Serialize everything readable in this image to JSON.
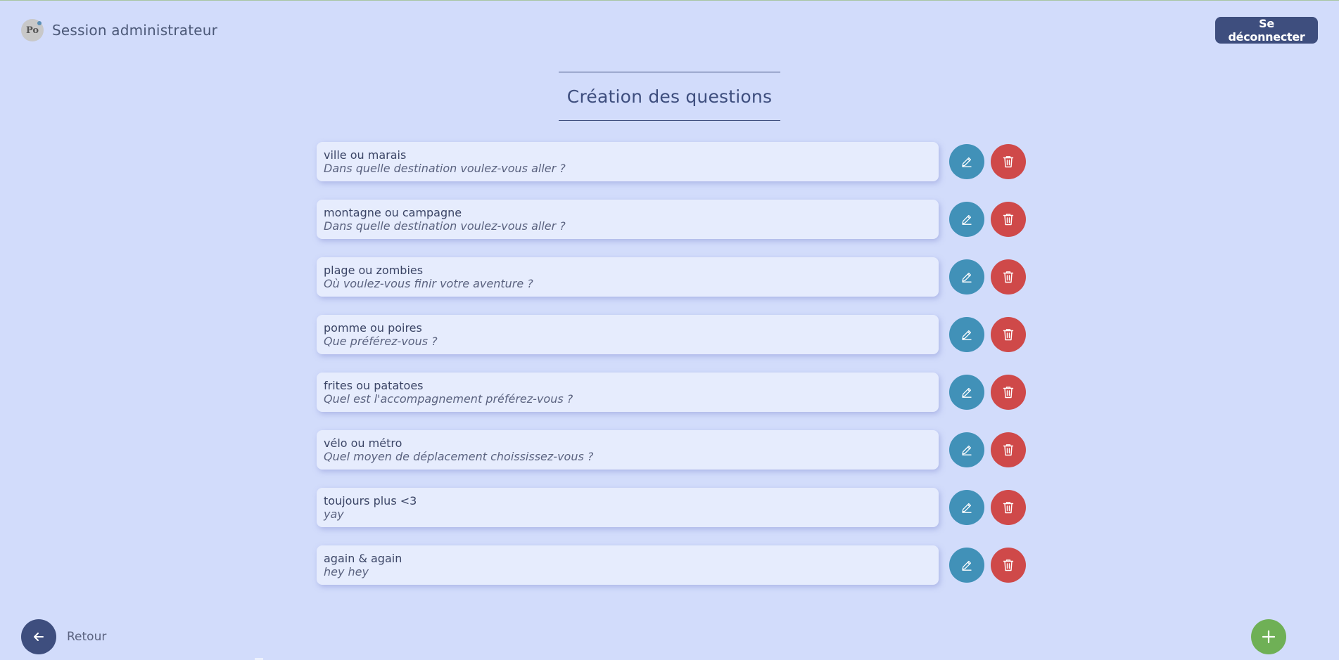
{
  "header": {
    "logo_text": "Po",
    "session_title": "Session administrateur",
    "logout_label": "Se déconnecter"
  },
  "main": {
    "page_title": "Création des questions",
    "questions": [
      {
        "title": "ville ou marais",
        "subtitle": "Dans quelle destination voulez-vous aller ?"
      },
      {
        "title": "montagne ou campagne",
        "subtitle": "Dans quelle destination voulez-vous aller ?"
      },
      {
        "title": "plage ou zombies",
        "subtitle": "Où voulez-vous finir votre aventure ?"
      },
      {
        "title": "pomme ou poires",
        "subtitle": "Que préférez-vous ?"
      },
      {
        "title": "frites ou patatoes",
        "subtitle": "Quel est l'accompagnement préférez-vous ?"
      },
      {
        "title": "vélo ou métro",
        "subtitle": "Quel moyen de déplacement choississez-vous ?"
      },
      {
        "title": "toujours plus <3",
        "subtitle": "yay"
      },
      {
        "title": "again & again",
        "subtitle": "hey hey"
      }
    ]
  },
  "footer": {
    "back_label": "Retour"
  },
  "icons": {
    "edit": "pencil-icon",
    "delete": "trash-icon",
    "back": "arrow-left-icon",
    "add": "plus-icon"
  },
  "colors": {
    "background": "#d2dcfb",
    "primary": "#3e4e7e",
    "edit": "#4191b8",
    "delete": "#cf4949",
    "add": "#6fb056",
    "card": "#e6ecfd"
  }
}
